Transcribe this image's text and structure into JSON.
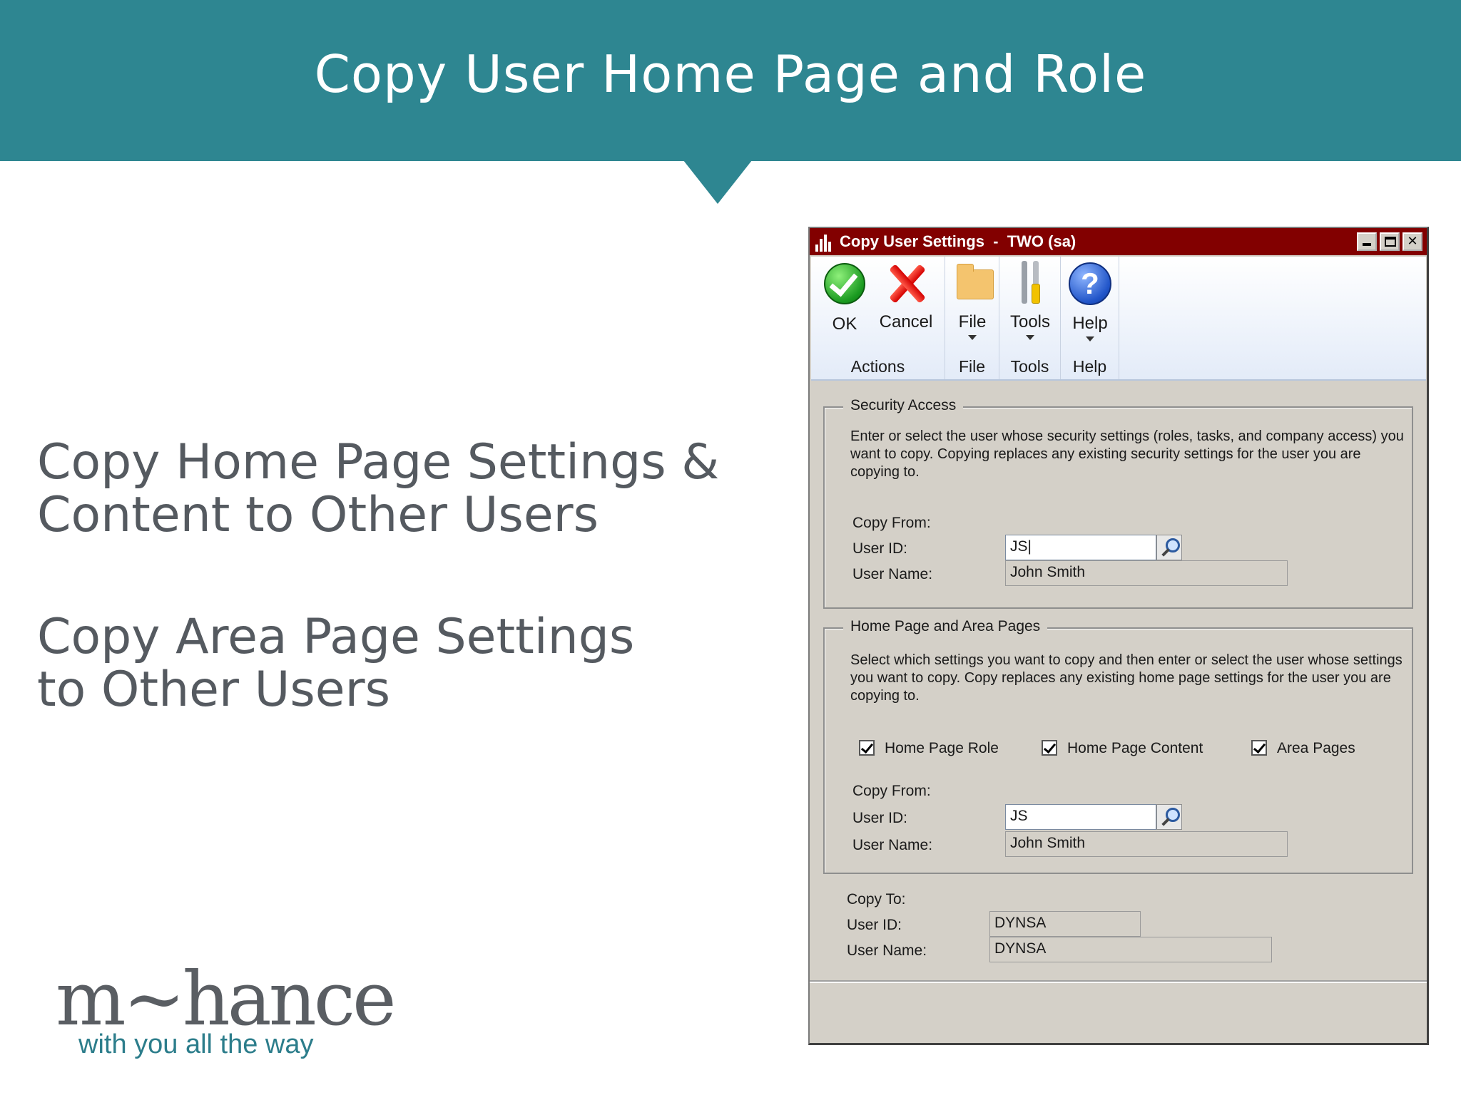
{
  "slide": {
    "title": "Copy User Home Page and Role",
    "bullets": [
      {
        "line1": "Copy Home Page Settings &",
        "line2": "Content to Other Users"
      },
      {
        "line1": "Copy Area Page Settings",
        "line2": "to Other Users"
      }
    ],
    "logo": {
      "word": "m~hance",
      "tagline": "with you all the way"
    },
    "colors": {
      "header": "#2e8691",
      "text": "#555a60"
    }
  },
  "window": {
    "title": "Copy User Settings  -  TWO (sa)",
    "titlebar_color": "#820000",
    "controls": {
      "minimize": "minimize-icon",
      "maximize": "maximize-icon",
      "close": "close-icon",
      "close_glyph": "✕"
    },
    "ribbon": {
      "groups": [
        {
          "label": "Actions",
          "buttons": [
            {
              "label": "OK",
              "icon": "ok-check-icon"
            },
            {
              "label": "Cancel",
              "icon": "cancel-x-icon"
            }
          ]
        },
        {
          "label": "File",
          "buttons": [
            {
              "label": "File",
              "icon": "folder-icon"
            }
          ]
        },
        {
          "label": "Tools",
          "buttons": [
            {
              "label": "Tools",
              "icon": "tools-icon"
            }
          ]
        },
        {
          "label": "Help",
          "buttons": [
            {
              "label": "Help",
              "icon": "help-icon",
              "glyph": "?"
            }
          ]
        }
      ]
    },
    "security_access": {
      "heading": "Security Access",
      "description": "Enter or select the user whose security settings (roles, tasks, and company access) you want to copy. Copying replaces any existing security settings for the user you are copying to.",
      "copy_from_label": "Copy From:",
      "user_id_label": "User ID:",
      "user_id_value": "JS|",
      "user_name_label": "User Name:",
      "user_name_value": "John Smith"
    },
    "home_page": {
      "heading": "Home Page and Area Pages",
      "description": "Select which settings you want to copy and then enter or select the user whose settings you want to copy. Copy replaces any existing home page settings for the user you are copying to.",
      "checkboxes": [
        {
          "label": "Home Page Role",
          "checked": true
        },
        {
          "label": "Home Page Content",
          "checked": true
        },
        {
          "label": "Area Pages",
          "checked": true
        }
      ],
      "copy_from_label": "Copy From:",
      "user_id_label": "User ID:",
      "user_id_value": "JS",
      "user_name_label": "User Name:",
      "user_name_value": "John Smith"
    },
    "copy_to": {
      "copy_to_label": "Copy To:",
      "user_id_label": "User ID:",
      "user_id_value": "DYNSA",
      "user_name_label": "User Name:",
      "user_name_value": "DYNSA"
    }
  }
}
